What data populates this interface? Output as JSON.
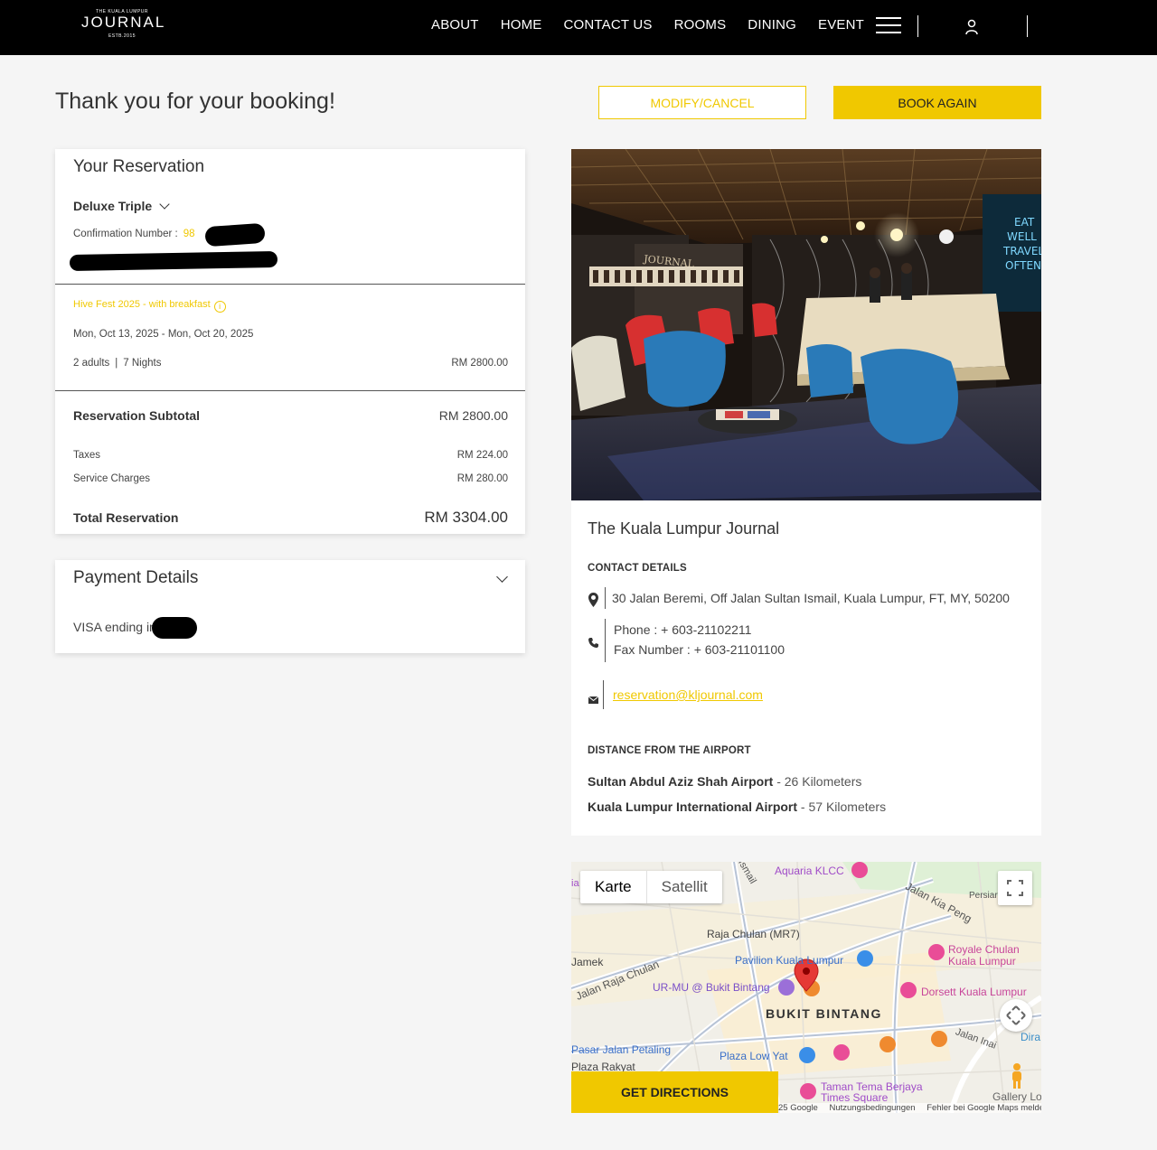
{
  "header": {
    "logo": {
      "top": "THE KUALA LUMPUR",
      "main": "JOURNAL",
      "bottom": "ESTB.2015"
    },
    "nav": [
      "ABOUT",
      "HOME",
      "CONTACT US",
      "ROOMS",
      "DINING",
      "EVENT"
    ]
  },
  "page": {
    "title": "Thank you for your booking!",
    "modify_label": "MODIFY/CANCEL",
    "book_again_label": "BOOK AGAIN"
  },
  "reservation": {
    "heading": "Your Reservation",
    "room_type": "Deluxe Triple",
    "confirmation_label": "Confirmation Number :",
    "confirmation_value": "98",
    "rate_name": "Hive Fest 2025 - with breakfast",
    "dates": "Mon, Oct 13, 2025 - Mon, Oct 20, 2025",
    "adults": "2 adults",
    "separator": "|",
    "nights": "7 Nights",
    "room_price": "RM 2800.00",
    "subtotal_label": "Reservation Subtotal",
    "subtotal_value": "RM 2800.00",
    "taxes_label": "Taxes",
    "taxes_value": "RM 224.00",
    "service_label": "Service Charges",
    "service_value": "RM 280.00",
    "total_label": "Total Reservation",
    "total_value": "RM 3304.00"
  },
  "payment": {
    "heading": "Payment Details",
    "card_text": "VISA ending in"
  },
  "hotel": {
    "name": "The Kuala Lumpur Journal",
    "contact_heading": "CONTACT DETAILS",
    "address": "30 Jalan Beremi, Off Jalan Sultan Ismail, Kuala Lumpur, FT, MY, 50200",
    "phone": "Phone : + 603-21102211",
    "fax": "Fax Number : + 603-21101100",
    "email": "reservation@kljournal.com",
    "distance_heading": "DISTANCE FROM THE AIRPORT",
    "airports": [
      {
        "name": "Sultan Abdul Aziz Shah Airport",
        "distance": " - 26 Kilometers"
      },
      {
        "name": "Kuala Lumpur International Airport",
        "distance": " - 57 Kilometers"
      }
    ]
  },
  "map": {
    "tab_map": "Karte",
    "tab_satellite": "Satellit",
    "directions_label": "GET DIRECTIONS",
    "labels": {
      "aquaria": "Aquaria KLCC",
      "raja_chulan": "Raja Chulan (MR7)",
      "pavilion": "Pavilion Kuala Lumpur",
      "royale_1": "Royale Chulan",
      "royale_2": "Kuala Lumpur",
      "urmu": "UR-MU @ Bukit Bintang",
      "dorsett": "Dorsett Kuala Lumpur",
      "bukit_bintang": "BUKIT BINTANG",
      "pasar": "Pasar Jalan Petaling",
      "plaza_rakyat": "Plaza Rakyat",
      "plaza_low_yat": "Plaza Low Yat",
      "taman_1": "Taman Tema Berjaya",
      "taman_2": "Times Square",
      "jalan_raja_chulan": "Jalan Raja Chulan",
      "jalan_kia_peng": "Jalan Kia Peng",
      "jalan_inai": "Jalan Inai",
      "persiaran": "Persiar",
      "ismail": "Ismail",
      "jamek": "Jamek",
      "dira": "Dira",
      "gallery": "Gallery Lo",
      "klcc_left": "ia"
    },
    "footer": {
      "copyright": "25 Google",
      "terms": "Nutzungsbedingungen",
      "report": "Fehler bei Google Maps melden"
    }
  },
  "colors": {
    "accent": "#f0c800",
    "header_bg": "#000000",
    "page_bg": "#f5f5f5"
  }
}
